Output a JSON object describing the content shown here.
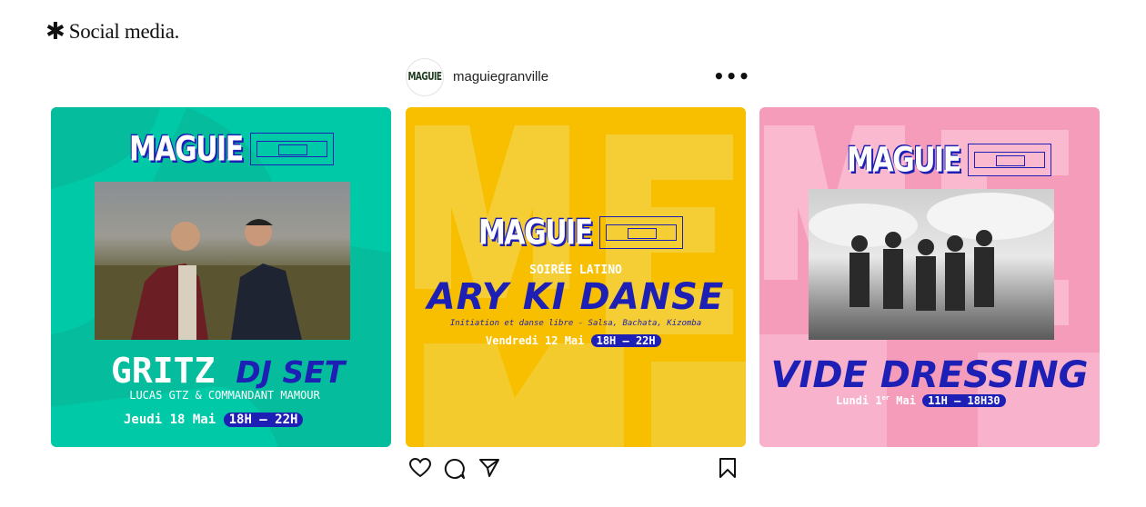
{
  "section_heading": {
    "icon": "asterisk-icon",
    "text": "Social media."
  },
  "post": {
    "avatar_text": "MAGUIE",
    "username": "maguiegranville",
    "more_icon": "more-dots-icon"
  },
  "cards": [
    {
      "logo": "MAGUIE",
      "title_main": "GRITZ",
      "title_accent": "DJ SET",
      "subtitle": "LUCAS GTZ & COMMANDANT MAMOUR",
      "date": "Jeudi 18 Mai",
      "time": "18H — 22H",
      "bg": "#00c9a7",
      "bg_dark": "#0ab394"
    },
    {
      "logo": "MAGUIE",
      "kicker": "SOIRÉE LATINO",
      "title": "ARY KI DANSE",
      "subtitle": "Initiation et danse libre - Salsa, Bachata, Kizomba",
      "date": "Vendredi 12 Mai",
      "time": "18H — 22H",
      "bg": "#f8bf00",
      "bg_light": "#f2d44a"
    },
    {
      "logo": "MAGUIE",
      "title": "VIDE DRESSING",
      "date_prefix": "Lundi 1",
      "date_sup": "er",
      "date_suffix": "Mai",
      "time": "11H — 18H30",
      "bg": "#f59cbb",
      "bg_light": "#fbc1d5"
    }
  ],
  "actions": {
    "like": "heart-icon",
    "comment": "comment-icon",
    "share": "share-icon",
    "save": "bookmark-icon"
  },
  "colors": {
    "accent_blue": "#1d1fb5"
  }
}
